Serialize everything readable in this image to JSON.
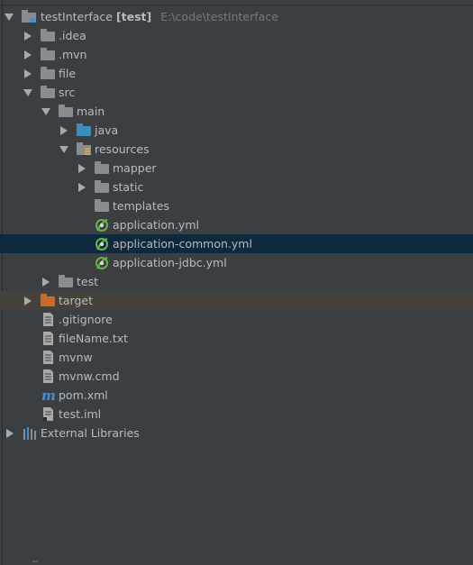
{
  "project": {
    "name": "testInterface",
    "module": "[test]",
    "path": "E:\\code\\testInterface"
  },
  "tree": {
    "idea": ".idea",
    "mvn": ".mvn",
    "file": "file",
    "src": "src",
    "main": "main",
    "java": "java",
    "resources": "resources",
    "mapper": "mapper",
    "static": "static",
    "templates": "templates",
    "app_yml": "application.yml",
    "app_common_yml": "application-common.yml",
    "app_jdbc_yml": "application-jdbc.yml",
    "test": "test",
    "target": "target",
    "gitignore": ".gitignore",
    "filename_txt": "fileName.txt",
    "mvnw": "mvnw",
    "mvnw_cmd": "mvnw.cmd",
    "pom": "pom.xml",
    "test_iml": "test.iml",
    "external_libraries": "External Libraries"
  },
  "colors": {
    "background": "#3c3f41",
    "selected_row": "#0d293e",
    "excluded_row": "#45423c",
    "text": "#bbbbbb",
    "path_text": "#787878",
    "folder_gray": "#8a8d90",
    "folder_blue": "#3c8cbc",
    "folder_orange": "#c76a2c",
    "spring_green": "#6ab04c",
    "maven_blue": "#4b8bd4"
  }
}
